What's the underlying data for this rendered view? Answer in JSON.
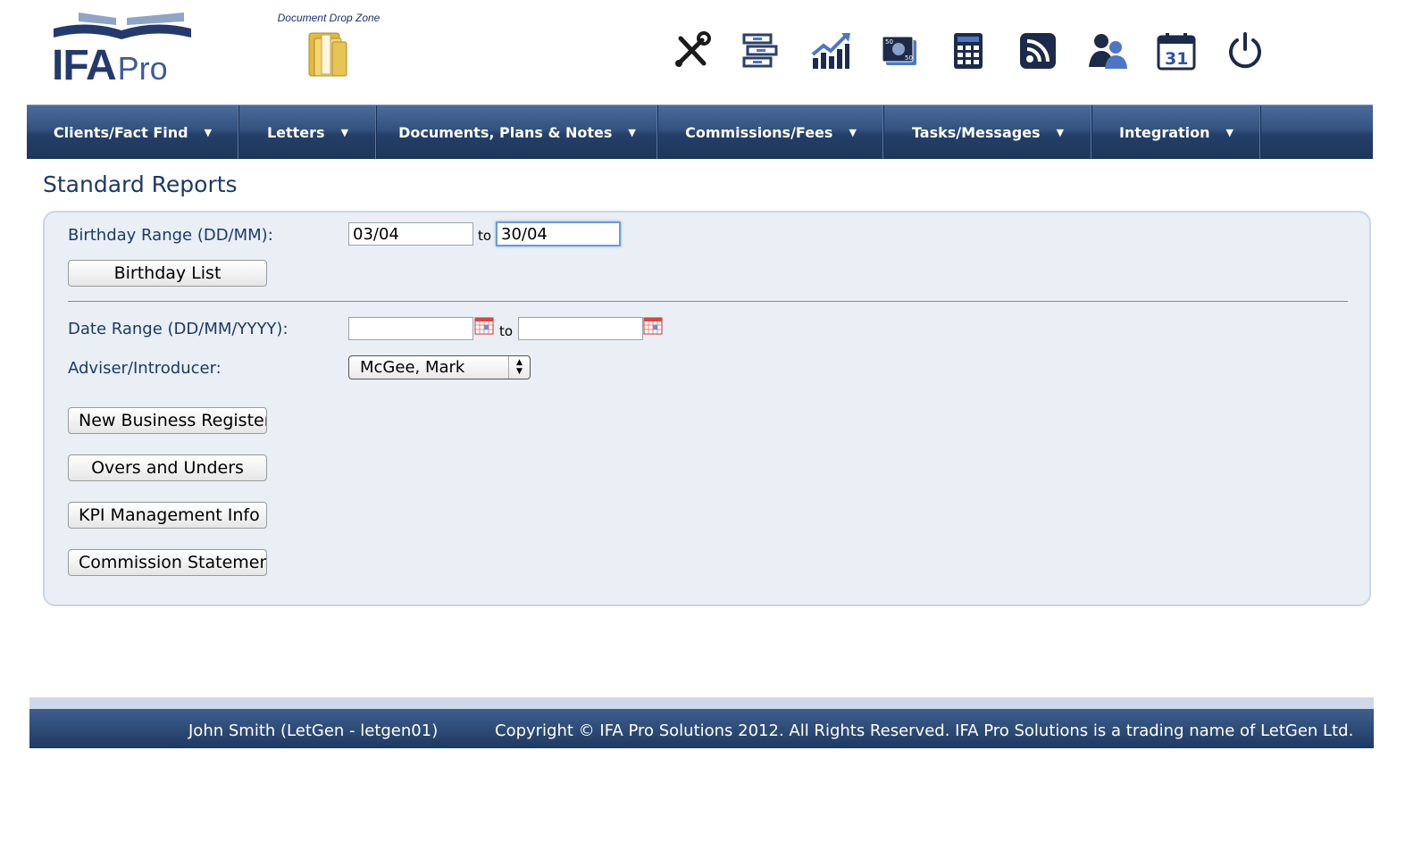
{
  "header": {
    "logo": {
      "ifa": "IFA",
      "pro": "Pro"
    },
    "drop_zone_label": "Document Drop Zone",
    "toolbar_icons": [
      "tools-icon",
      "filing-cabinet-icon",
      "chart-growth-icon",
      "money-icon",
      "calculator-icon",
      "rss-feed-icon",
      "users-icon",
      "calendar-icon",
      "power-icon"
    ]
  },
  "nav": {
    "items": [
      {
        "label": "Clients/Fact Find"
      },
      {
        "label": "Letters"
      },
      {
        "label": "Documents, Plans & Notes"
      },
      {
        "label": "Commissions/Fees"
      },
      {
        "label": "Tasks/Messages"
      },
      {
        "label": "Integration"
      }
    ]
  },
  "page": {
    "title": "Standard Reports",
    "birthday": {
      "label": "Birthday Range (DD/MM):",
      "from": "03/04",
      "to_label": "to",
      "to": "30/04",
      "button": "Birthday List"
    },
    "date_range": {
      "label": "Date Range (DD/MM/YYYY):",
      "from": "",
      "to_label": "to",
      "to": ""
    },
    "adviser": {
      "label": "Adviser/Introducer:",
      "selected": "McGee, Mark"
    },
    "buttons": {
      "new_business": "New Business Register",
      "overs_unders": "Overs and Unders",
      "kpi": "KPI Management Info",
      "commission": "Commission Statement"
    }
  },
  "footer": {
    "user": "John Smith (LetGen - letgen01)",
    "copyright": "Copyright © IFA Pro Solutions 2012. All Rights Reserved. IFA Pro Solutions is a trading name of LetGen Ltd."
  },
  "colors": {
    "nav_dark": "#1d365c",
    "brand_blue": "#243a6c",
    "panel_bg": "#e9eff4"
  }
}
